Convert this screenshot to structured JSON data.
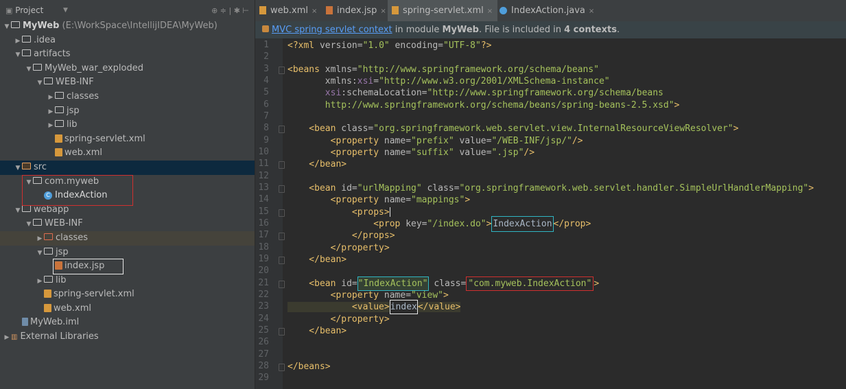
{
  "project": {
    "title": "Project",
    "toolbar_icons": "⊕ ≑ | ✱ ⊢",
    "tree": [
      {
        "label": "MyWeb",
        "detail": " (E:\\WorkSpace\\IntellijIDEA\\MyWeb)",
        "depth": 0,
        "arrow": "▼",
        "icon": "folder",
        "bold": true
      },
      {
        "label": ".idea",
        "depth": 1,
        "arrow": "▶",
        "icon": "folder"
      },
      {
        "label": "artifacts",
        "depth": 1,
        "arrow": "▼",
        "icon": "folder"
      },
      {
        "label": "MyWeb_war_exploded",
        "depth": 2,
        "arrow": "▼",
        "icon": "folder"
      },
      {
        "label": "WEB-INF",
        "depth": 3,
        "arrow": "▼",
        "icon": "folder"
      },
      {
        "label": "classes",
        "depth": 4,
        "arrow": "▶",
        "icon": "folder"
      },
      {
        "label": "jsp",
        "depth": 4,
        "arrow": "▶",
        "icon": "folder"
      },
      {
        "label": "lib",
        "depth": 4,
        "arrow": "▶",
        "icon": "folder"
      },
      {
        "label": "spring-servlet.xml",
        "depth": 4,
        "arrow": "",
        "icon": "xml"
      },
      {
        "label": "web.xml",
        "depth": 4,
        "arrow": "",
        "icon": "xml"
      },
      {
        "label": "src",
        "depth": 1,
        "arrow": "▼",
        "icon": "src",
        "state": "selected"
      },
      {
        "label": "com.myweb",
        "depth": 2,
        "arrow": "▼",
        "icon": "package"
      },
      {
        "label": "IndexAction",
        "depth": 3,
        "arrow": "",
        "icon": "class"
      },
      {
        "label": "webapp",
        "depth": 1,
        "arrow": "▼",
        "icon": "package"
      },
      {
        "label": "WEB-INF",
        "depth": 2,
        "arrow": "▼",
        "icon": "folder"
      },
      {
        "label": "classes",
        "depth": 3,
        "arrow": "▶",
        "icon": "excluded",
        "state": "highlight"
      },
      {
        "label": "jsp",
        "depth": 3,
        "arrow": "▼",
        "icon": "folder"
      },
      {
        "label": "index.jsp",
        "depth": 4,
        "arrow": "",
        "icon": "jsp"
      },
      {
        "label": "lib",
        "depth": 3,
        "arrow": "▶",
        "icon": "folder"
      },
      {
        "label": "spring-servlet.xml",
        "depth": 3,
        "arrow": "",
        "icon": "xml"
      },
      {
        "label": "web.xml",
        "depth": 3,
        "arrow": "",
        "icon": "xml"
      },
      {
        "label": "MyWeb.iml",
        "depth": 1,
        "arrow": "",
        "icon": "iml"
      },
      {
        "label": "External Libraries",
        "depth": 0,
        "arrow": "▶",
        "icon": "libs"
      }
    ]
  },
  "tabs": [
    {
      "label": "web.xml",
      "icon": "xml",
      "active": false
    },
    {
      "label": "index.jsp",
      "icon": "jsp",
      "active": false
    },
    {
      "label": "spring-servlet.xml",
      "icon": "xml",
      "active": true
    },
    {
      "label": "IndexAction.java",
      "icon": "class",
      "active": false
    }
  ],
  "banner": {
    "link": "MVC spring servlet context",
    "text1": " in module ",
    "module": "MyWeb",
    "text2": ". File is included in ",
    "contexts": "4 contexts",
    "text3": "."
  },
  "editor": {
    "line_numbers": [
      "1",
      "2",
      "3",
      "4",
      "5",
      "6",
      "7",
      "8",
      "9",
      "10",
      "11",
      "12",
      "13",
      "14",
      "15",
      "16",
      "17",
      "18",
      "19",
      "20",
      "21",
      "22",
      "23",
      "24",
      "25",
      "26",
      "27",
      "28",
      "29"
    ],
    "lines": [
      [
        [
          "tg",
          "<?xml "
        ],
        [
          "at",
          "version="
        ],
        [
          "st",
          "\"1.0\""
        ],
        [
          "at",
          " encoding="
        ],
        [
          "st",
          "\"UTF-8\""
        ],
        [
          "tg",
          "?>"
        ]
      ],
      [],
      [
        [
          "tg",
          "<beans "
        ],
        [
          "at",
          "xmlns="
        ],
        [
          "st",
          "\"http://www.springframework.org/schema/beans\""
        ]
      ],
      [
        [
          "at",
          "       xmlns:"
        ],
        [
          "ns",
          "xsi"
        ],
        [
          "at",
          "="
        ],
        [
          "st",
          "\"http://www.w3.org/2001/XMLSchema-instance\""
        ]
      ],
      [
        [
          "ns",
          "       xsi"
        ],
        [
          "at",
          ":schemaLocation="
        ],
        [
          "st",
          "\"http://www.springframework.org/schema/beans"
        ]
      ],
      [
        [
          "st",
          "       http://www.springframework.org/schema/beans/spring-beans-2.5.xsd\""
        ],
        [
          "tg",
          ">"
        ]
      ],
      [],
      [
        [
          "tg",
          "    <bean "
        ],
        [
          "at",
          "class="
        ],
        [
          "st",
          "\"org.springframework.web.servlet.view.InternalResourceViewResolver\""
        ],
        [
          "tg",
          ">"
        ]
      ],
      [
        [
          "tg",
          "        <property "
        ],
        [
          "at",
          "name="
        ],
        [
          "st",
          "\"prefix\""
        ],
        [
          "at",
          " value="
        ],
        [
          "st",
          "\"/WEB-INF/jsp/\""
        ],
        [
          "tg",
          "/>"
        ]
      ],
      [
        [
          "tg",
          "        <property "
        ],
        [
          "at",
          "name="
        ],
        [
          "st",
          "\"suffix\""
        ],
        [
          "at",
          " value="
        ],
        [
          "st",
          "\".jsp\""
        ],
        [
          "tg",
          "/>"
        ]
      ],
      [
        [
          "tg",
          "    </bean>"
        ]
      ],
      [],
      [
        [
          "tg",
          "    <bean "
        ],
        [
          "at",
          "id="
        ],
        [
          "st",
          "\"urlMapping\""
        ],
        [
          "at",
          " class="
        ],
        [
          "st",
          "\"org.springframework.web.servlet.handler.SimpleUrlHandlerMapping\""
        ],
        [
          "tg",
          ">"
        ]
      ],
      [
        [
          "tg",
          "        <property "
        ],
        [
          "at",
          "name="
        ],
        [
          "st",
          "\"mappings\""
        ],
        [
          "tg",
          ">"
        ]
      ],
      [
        [
          "tg",
          "            <props>"
        ],
        [
          "caret",
          ""
        ]
      ],
      [
        [
          "tg",
          "                <prop "
        ],
        [
          "at",
          "key="
        ],
        [
          "st",
          "\"/index.do\""
        ],
        [
          "tg",
          ">"
        ],
        [
          "pl-cyan",
          "IndexAction"
        ],
        [
          "tg",
          "</prop>"
        ]
      ],
      [
        [
          "tg",
          "            </props>"
        ]
      ],
      [
        [
          "tg",
          "        </property>"
        ]
      ],
      [
        [
          "tg",
          "    </bean>"
        ]
      ],
      [],
      [
        [
          "tg",
          "    <bean "
        ],
        [
          "at",
          "id="
        ],
        [
          "st-cyan",
          "\"IndexAction\""
        ],
        [
          "at",
          " class="
        ],
        [
          "st-red",
          "\"com.myweb.IndexAction\""
        ],
        [
          "tg",
          ">"
        ]
      ],
      [
        [
          "tg",
          "        <property "
        ],
        [
          "at",
          "name="
        ],
        [
          "st",
          "\"view\""
        ],
        [
          "tg",
          ">"
        ]
      ],
      [
        [
          "tg-bg",
          "            <value>"
        ],
        [
          "pl-white",
          "index"
        ],
        [
          "tg-bg",
          "</value>"
        ]
      ],
      [
        [
          "tg",
          "        </property>"
        ]
      ],
      [
        [
          "tg",
          "    </bean>"
        ]
      ],
      [],
      [],
      [
        [
          "tg",
          "</beans>"
        ]
      ],
      []
    ]
  }
}
